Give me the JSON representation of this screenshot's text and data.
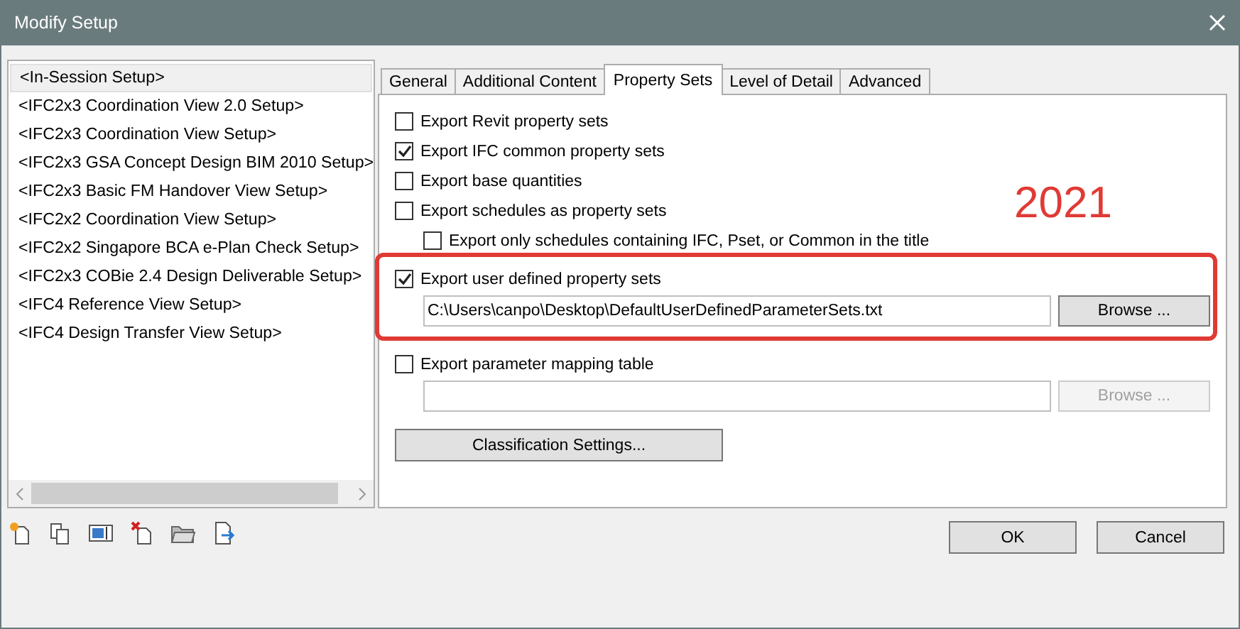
{
  "window": {
    "title": "Modify Setup"
  },
  "setups": [
    {
      "label": "<In-Session Setup>",
      "selected": true
    },
    {
      "label": "<IFC2x3 Coordination View 2.0 Setup>",
      "selected": false
    },
    {
      "label": "<IFC2x3 Coordination View Setup>",
      "selected": false
    },
    {
      "label": "<IFC2x3 GSA Concept Design BIM 2010 Setup>",
      "selected": false
    },
    {
      "label": "<IFC2x3 Basic FM Handover View Setup>",
      "selected": false
    },
    {
      "label": "<IFC2x2 Coordination View Setup>",
      "selected": false
    },
    {
      "label": "<IFC2x2 Singapore BCA e-Plan Check Setup>",
      "selected": false
    },
    {
      "label": "<IFC2x3 COBie 2.4 Design Deliverable Setup>",
      "selected": false
    },
    {
      "label": "<IFC4 Reference View Setup>",
      "selected": false
    },
    {
      "label": "<IFC4 Design Transfer View Setup>",
      "selected": false
    }
  ],
  "tabs": [
    {
      "label": "General",
      "selected": false
    },
    {
      "label": "Additional Content",
      "selected": false
    },
    {
      "label": "Property Sets",
      "selected": true
    },
    {
      "label": "Level of Detail",
      "selected": false
    },
    {
      "label": "Advanced",
      "selected": false
    }
  ],
  "options": [
    {
      "kind": "checkbox",
      "label": "Export Revit property sets",
      "checked": false
    },
    {
      "kind": "checkbox",
      "label": "Export IFC common property sets",
      "checked": true
    },
    {
      "kind": "checkbox",
      "label": "Export base quantities",
      "checked": false
    },
    {
      "kind": "checkbox",
      "label": "Export schedules as property sets",
      "checked": false,
      "children": [
        {
          "kind": "checkbox",
          "label": "Export only schedules containing IFC, Pset, or Common in the title",
          "checked": false
        }
      ]
    },
    {
      "kind": "file",
      "label": "Export user defined property sets",
      "checked": true,
      "highlighted": true,
      "value": "C:\\Users\\canpo\\Desktop\\DefaultUserDefinedParameterSets.txt",
      "button": {
        "label": "Browse ...",
        "disabled": false
      }
    },
    {
      "kind": "file",
      "label": "Export parameter mapping table",
      "checked": false,
      "highlighted": false,
      "button": {
        "label": "Browse ...",
        "disabled": true
      }
    },
    {
      "kind": "button",
      "label": "Classification Settings..."
    }
  ],
  "annotation": {
    "label": "2021"
  },
  "buttons": [
    {
      "label": "OK"
    },
    {
      "label": "Cancel"
    }
  ]
}
